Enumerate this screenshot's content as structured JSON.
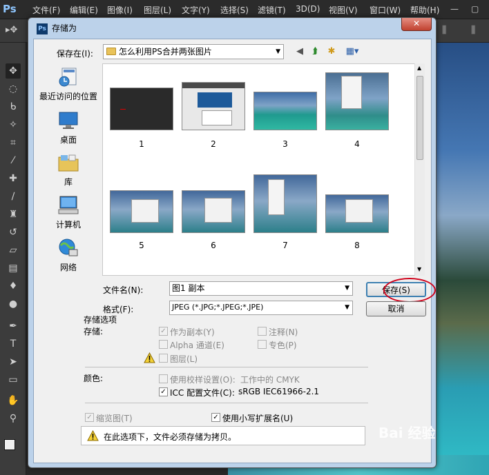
{
  "app": {
    "logo": "Ps",
    "menu": [
      "文件(F)",
      "编辑(E)",
      "图像(I)",
      "图层(L)",
      "文字(Y)",
      "选择(S)",
      "滤镜(T)",
      "3D(D)",
      "视图(V)",
      "窗口(W)",
      "帮助(H)"
    ],
    "window_controls": [
      "—",
      "▢"
    ]
  },
  "dialog": {
    "title": "存储为",
    "icon": "Ps",
    "close": "✕",
    "save_in_label": "保存在(I):",
    "save_in_value": "怎么利用PS合并两张图片",
    "places": [
      {
        "label": "最近访问的位置",
        "icon": "recent-places-icon"
      },
      {
        "label": "桌面",
        "icon": "desktop-icon"
      },
      {
        "label": "库",
        "icon": "libraries-icon"
      },
      {
        "label": "计算机",
        "icon": "computer-icon"
      },
      {
        "label": "网络",
        "icon": "network-icon"
      }
    ],
    "files": [
      "1",
      "2",
      "3",
      "4",
      "5",
      "6",
      "7",
      "8"
    ],
    "filename_label": "文件名(N):",
    "filename_value": "图1 副本",
    "format_label": "格式(F):",
    "format_value": "JPEG (*.JPG;*.JPEG;*.JPE)",
    "save_button": "保存(S)",
    "cancel_button": "取消"
  },
  "options": {
    "title": "存储选项",
    "store_label": "存储:",
    "as_copy": "作为副本(Y)",
    "notes": "注释(N)",
    "alpha": "Alpha 通道(E)",
    "spot": "专色(P)",
    "layers": "图层(L)",
    "color_label": "颜色:",
    "proof_setup": "使用校样设置(O):",
    "proof_value": "工作中的 CMYK",
    "icc_profile": "ICC 配置文件(C):",
    "icc_value": "sRGB IEC61966-2.1",
    "thumbnail": "缩览图(T)",
    "lowercase_ext": "使用小写扩展名(U)",
    "notice": "在此选项下，文件必须存储为拷贝。",
    "checked": {
      "as_copy": true,
      "notes": false,
      "alpha": false,
      "spot": false,
      "layers": false,
      "proof": false,
      "icc": true,
      "thumbnail": true,
      "lowercase": true
    }
  },
  "watermark": "Bai 经验"
}
